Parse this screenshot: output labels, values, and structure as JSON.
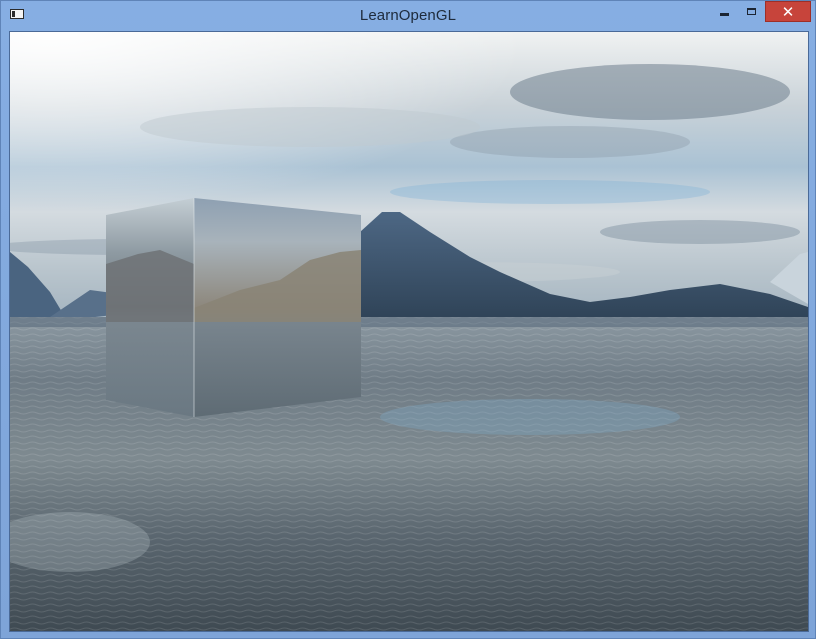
{
  "window": {
    "title": "LearnOpenGL",
    "icon": "window-app-icon",
    "controls": {
      "minimize": "minimize-icon",
      "maximize": "maximize-icon",
      "close_glyph": "✕"
    }
  },
  "scene": {
    "sky_colors": [
      "#eef1f2",
      "#b8c7d3",
      "#8fb6d6",
      "#dfe3e1"
    ],
    "water_colors": [
      "#5b6872",
      "#7d8a92",
      "#43505a"
    ],
    "mountain_color": "#3f566f",
    "cube_colors": [
      "#9aa5ab",
      "#7c8790",
      "#5d6a74"
    ]
  }
}
